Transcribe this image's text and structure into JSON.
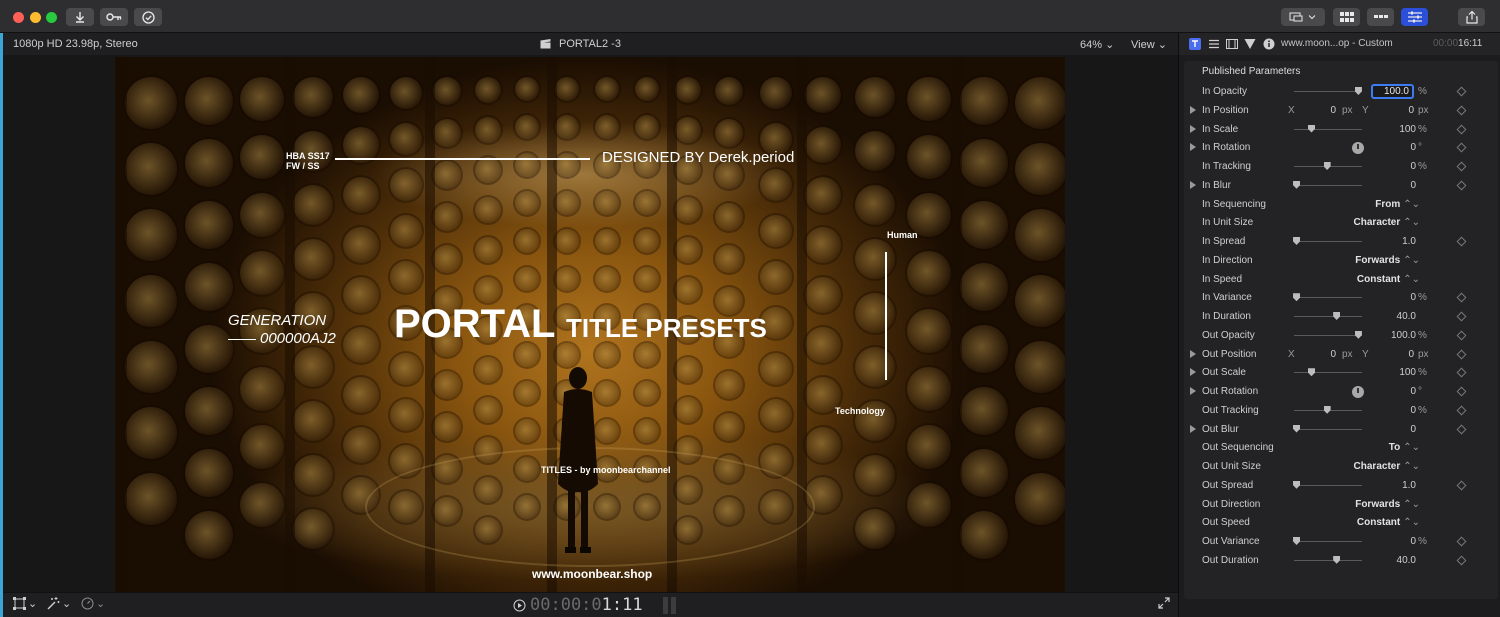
{
  "toolbar": {
    "buttons": [
      "import-icon",
      "keyword-icon",
      "checkmark-icon"
    ],
    "right_buttons": [
      "display-options-icon",
      "browser-icon",
      "timeline-icon",
      "inspector-icon",
      "share-icon"
    ]
  },
  "viewer": {
    "format": "1080p HD 23.98p, Stereo",
    "clip_name": "PORTAL2 -3",
    "zoom": "64%",
    "view_label": "View"
  },
  "overlay": {
    "hba_line1": "HBA SS17",
    "hba_line2": "FW / SS",
    "designed_by": "DESIGNED BY Derek.period",
    "generation": "GENERATION",
    "gen_code": "000000AJ2",
    "portal": "PORTAL",
    "title_presets": "TITLE PRESETS",
    "human": "Human",
    "technology": "Technology",
    "titles_by": "TITLES - by moonbearchannel",
    "shop": "www.moonbear.shop"
  },
  "footer": {
    "timecode_dim": "00:00:0",
    "timecode_bright": "1:11"
  },
  "inspector": {
    "header_title": "www.moon...op - Custom",
    "time_dim": "00:00",
    "time_bright": "16:11",
    "section_title": "Published Parameters",
    "params": [
      {
        "label": "In Opacity",
        "kind": "slider",
        "level": 0.94,
        "value": "100.0",
        "unit": "%",
        "editing": true
      },
      {
        "label": "In Position",
        "kind": "xy",
        "expand": true,
        "x_label": "X",
        "x": "0",
        "x_unit": "px",
        "y_label": "Y",
        "y": "0",
        "y_unit": "px"
      },
      {
        "label": "In Scale",
        "kind": "slider",
        "expand": true,
        "level": 0.25,
        "value": "100",
        "unit": "%"
      },
      {
        "label": "In Rotation",
        "kind": "dial",
        "expand": true,
        "value": "0",
        "unit": "°"
      },
      {
        "label": "In Tracking",
        "kind": "slider",
        "level": 0.48,
        "value": "0",
        "unit": "%"
      },
      {
        "label": "In Blur",
        "kind": "slider",
        "expand": true,
        "level": 0.03,
        "value": "0",
        "unit": ""
      },
      {
        "label": "In Sequencing",
        "kind": "popup",
        "value": "From"
      },
      {
        "label": "In Unit Size",
        "kind": "popup",
        "value": "Character"
      },
      {
        "label": "In Spread",
        "kind": "slider",
        "level": 0.03,
        "value": "1.0",
        "unit": ""
      },
      {
        "label": "In Direction",
        "kind": "popup",
        "value": "Forwards"
      },
      {
        "label": "In Speed",
        "kind": "popup",
        "value": "Constant"
      },
      {
        "label": "In Variance",
        "kind": "slider",
        "level": 0.03,
        "value": "0",
        "unit": "%"
      },
      {
        "label": "In Duration",
        "kind": "slider",
        "level": 0.62,
        "value": "40.0",
        "unit": ""
      },
      {
        "label": "Out Opacity",
        "kind": "slider",
        "level": 0.94,
        "value": "100.0",
        "unit": "%"
      },
      {
        "label": "Out Position",
        "kind": "xy",
        "expand": true,
        "x_label": "X",
        "x": "0",
        "x_unit": "px",
        "y_label": "Y",
        "y": "0",
        "y_unit": "px"
      },
      {
        "label": "Out Scale",
        "kind": "slider",
        "expand": true,
        "level": 0.25,
        "value": "100",
        "unit": "%"
      },
      {
        "label": "Out Rotation",
        "kind": "dial",
        "expand": true,
        "value": "0",
        "unit": "°"
      },
      {
        "label": "Out Tracking",
        "kind": "slider",
        "level": 0.48,
        "value": "0",
        "unit": "%"
      },
      {
        "label": "Out Blur",
        "kind": "slider",
        "expand": true,
        "level": 0.03,
        "value": "0",
        "unit": ""
      },
      {
        "label": "Out Sequencing",
        "kind": "popup",
        "value": "To"
      },
      {
        "label": "Out Unit Size",
        "kind": "popup",
        "value": "Character"
      },
      {
        "label": "Out Spread",
        "kind": "slider",
        "level": 0.03,
        "value": "1.0",
        "unit": ""
      },
      {
        "label": "Out Direction",
        "kind": "popup",
        "value": "Forwards"
      },
      {
        "label": "Out Speed",
        "kind": "popup",
        "value": "Constant"
      },
      {
        "label": "Out Variance",
        "kind": "slider",
        "level": 0.03,
        "value": "0",
        "unit": "%"
      },
      {
        "label": "Out Duration",
        "kind": "slider",
        "level": 0.62,
        "value": "40.0",
        "unit": ""
      }
    ]
  }
}
